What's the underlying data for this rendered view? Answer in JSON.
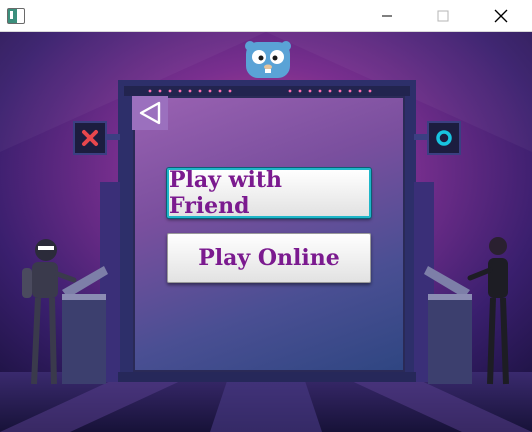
{
  "window": {
    "controls": [
      "minimize",
      "maximize",
      "close"
    ]
  },
  "menu": {
    "back_icon": "triangle-left-icon",
    "play_friend_label": "Play with Friend",
    "play_online_label": "Play Online"
  },
  "colors": {
    "button_text": "#7b1a8f",
    "focus_ring": "#1fb6c9",
    "panel_top": "#9a62b2",
    "panel_bottom": "#2f4682",
    "x_icon": "#e8474d",
    "o_icon": "#18c4e0"
  },
  "decor": {
    "mascot": "gopher-icon",
    "left_symbol": "x-icon",
    "right_symbol": "o-icon",
    "left_figure": "robot-figure",
    "right_figure": "human-figure"
  }
}
